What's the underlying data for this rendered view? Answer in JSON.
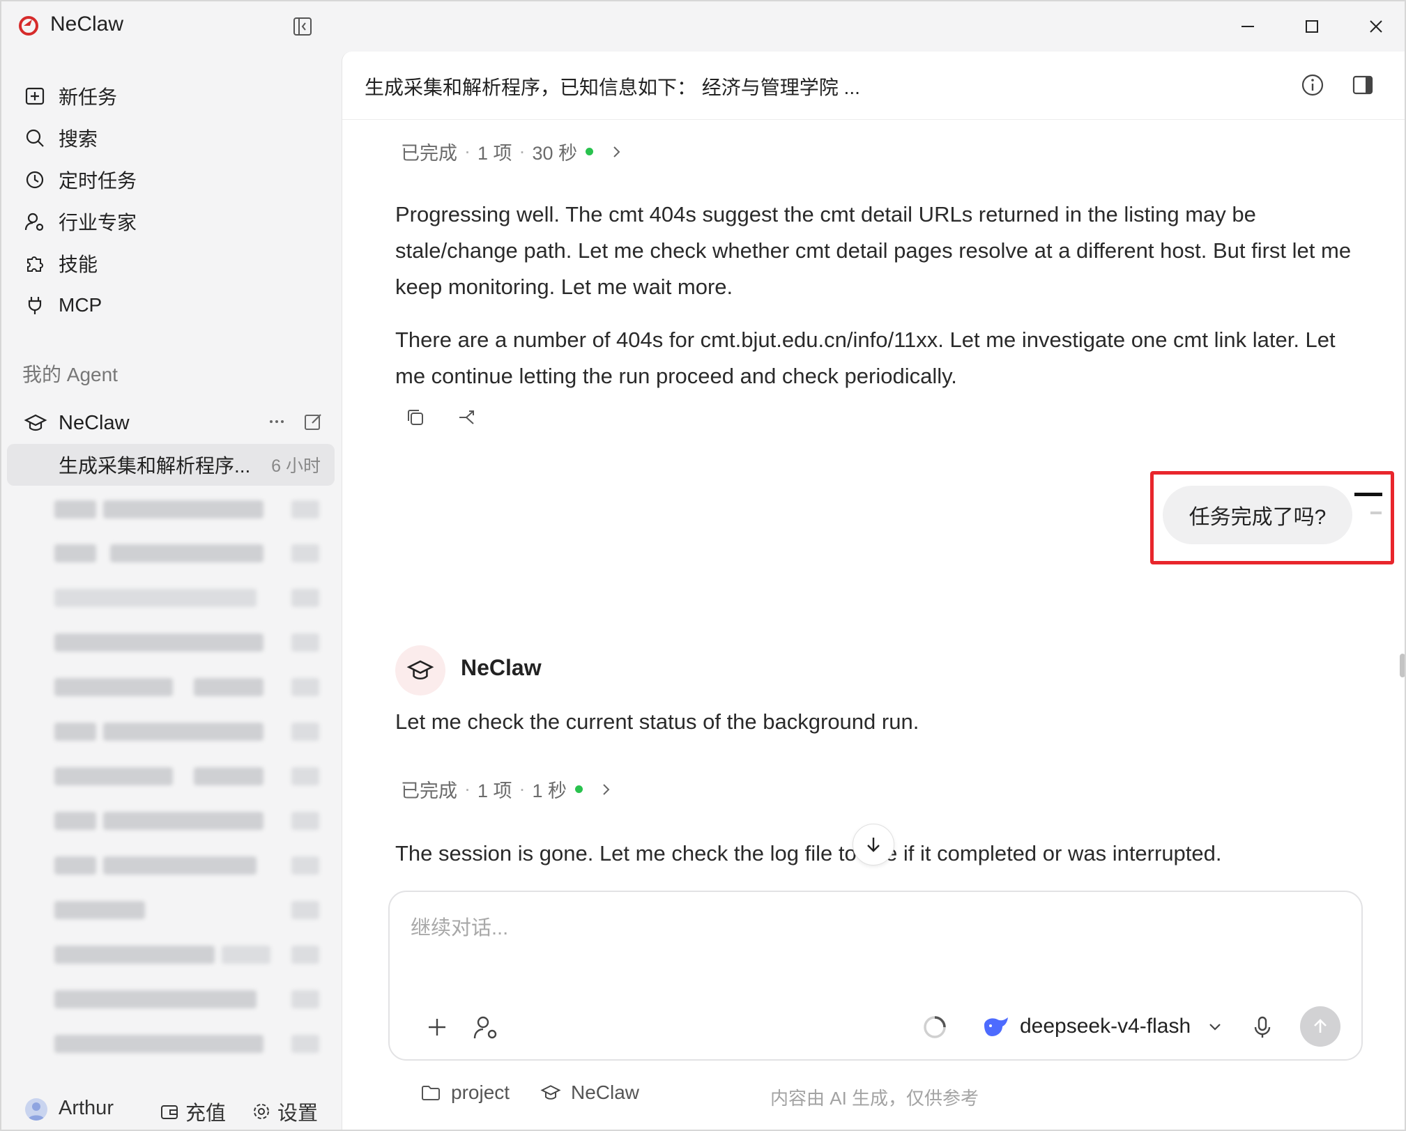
{
  "app": {
    "title": "NeClaw",
    "accent_color": "#d62b2b"
  },
  "sidebar": {
    "nav_items": [
      {
        "label": "新任务",
        "icon": "plus-square-icon"
      },
      {
        "label": "搜索",
        "icon": "search-icon"
      },
      {
        "label": "定时任务",
        "icon": "clock-icon"
      },
      {
        "label": "行业专家",
        "icon": "user-gear-icon"
      },
      {
        "label": "技能",
        "icon": "puzzle-icon"
      },
      {
        "label": "MCP",
        "icon": "plug-icon"
      }
    ],
    "section_label": "我的 Agent",
    "agent": {
      "name": "NeClaw",
      "icon": "graduation-cap-icon"
    },
    "active_session": {
      "title": "生成采集和解析程序...",
      "time": "6 小时"
    },
    "user": {
      "name": "Arthur"
    },
    "recharge_label": "充值",
    "settings_label": "设置"
  },
  "chat": {
    "title": "生成采集和解析程序，已知信息如下： 经济与管理学院 ...",
    "status1": {
      "state": "已完成",
      "count": "1 项",
      "duration": "30 秒"
    },
    "paragraph1": "Progressing well. The cmt 404s suggest the cmt detail URLs returned in the listing may be stale/change path. Let me check whether cmt detail pages resolve at a different host. But first let me keep monitoring. Let me wait more.",
    "paragraph2": "There are a number of 404s for cmt.bjut.edu.cn/info/11xx. Let me investigate one cmt link later. Let me continue letting the run proceed and check periodically.",
    "user_message": "任务完成了吗?",
    "bot_name": "NeClaw",
    "bot_reply": "Let me check the current status of the background run.",
    "status2": {
      "state": "已完成",
      "count": "1 项",
      "duration": "1 秒"
    },
    "paragraph3": "The session is gone. Let me check the log file to see if it completed or was interrupted."
  },
  "composer": {
    "placeholder": "继续对话...",
    "model_name": "deepseek-v4-flash"
  },
  "footer": {
    "folder_label": "project",
    "agent_label": "NeClaw",
    "disclaimer": "内容由 AI 生成，仅供参考"
  }
}
